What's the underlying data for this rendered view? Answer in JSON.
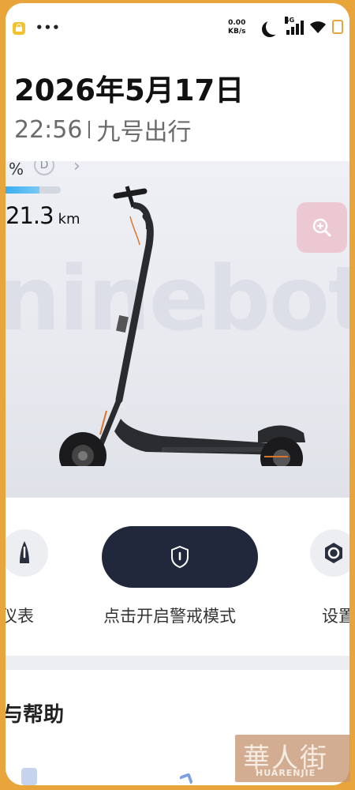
{
  "status_bar": {
    "net_speed_value": "0.00",
    "net_speed_unit": "KB/s",
    "network_type": "4G",
    "icons": [
      "lock-icon",
      "more-dots-icon",
      "moon-icon",
      "signal-icon",
      "wifi-icon",
      "battery-icon"
    ]
  },
  "header": {
    "date": "2026年5月17日",
    "time": "22:56",
    "app_name": "九号出行"
  },
  "vehicle": {
    "battery_percent_text": "%",
    "mode_badge": "D",
    "battery_level": 0.62,
    "range_value": "21.3",
    "range_unit": "km",
    "brand_watermark": "ninebot"
  },
  "actions": {
    "dashboard_label": "仪表",
    "alarm_label": "点击开启警戒模式",
    "settings_label": "设置"
  },
  "help": {
    "title": "与帮助"
  },
  "watermark": {
    "cn": "華人街",
    "en": "HUARENJIE"
  },
  "colors": {
    "frame": "#e8a53c",
    "alarm_button": "#22283c",
    "battery_bar": "#3aaef0",
    "zoom_button": "#ecc8d3"
  }
}
